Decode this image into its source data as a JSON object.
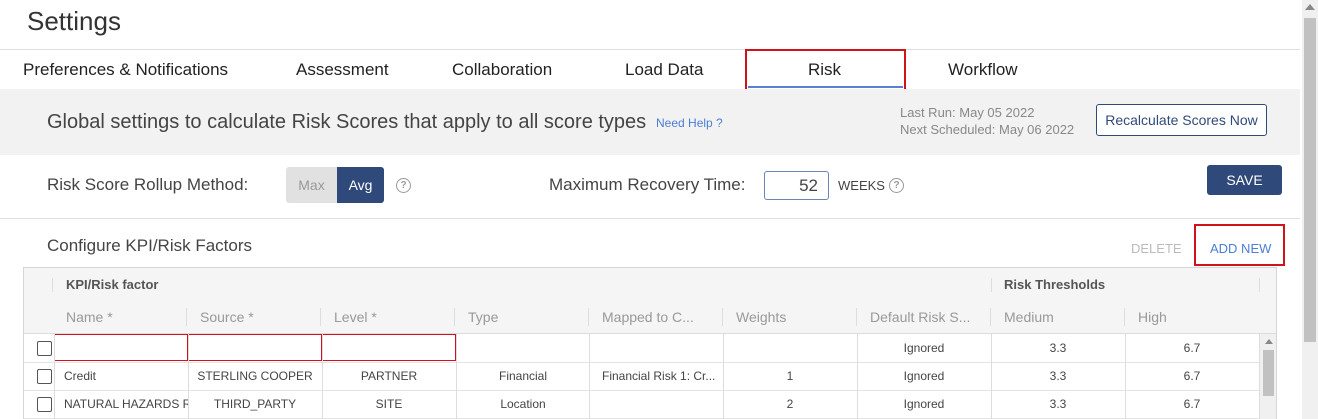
{
  "page": {
    "title": "Settings"
  },
  "tabs": [
    {
      "label": "Preferences & Notifications"
    },
    {
      "label": "Assessment"
    },
    {
      "label": "Collaboration"
    },
    {
      "label": "Load Data"
    },
    {
      "label": "Risk"
    },
    {
      "label": "Workflow"
    }
  ],
  "active_tab": "Risk",
  "global": {
    "text": "Global settings to calculate Risk Scores that apply to all score types",
    "help_link": "Need Help ?",
    "last_run": "Last Run: May 05 2022",
    "next_scheduled": "Next Scheduled: May 06 2022",
    "recalc_button": "Recalculate Scores Now"
  },
  "rollup": {
    "label": "Risk Score Rollup Method:",
    "options": [
      "Max",
      "Avg"
    ],
    "selected": "Avg"
  },
  "recovery": {
    "label": "Maximum Recovery Time:",
    "value": "52",
    "unit": "WEEKS"
  },
  "save_button": "SAVE",
  "kpi": {
    "title": "Configure KPI/Risk Factors",
    "delete_label": "DELETE",
    "add_new_label": "ADD NEW",
    "group_headers": {
      "factor": "KPI/Risk factor",
      "thresholds": "Risk Thresholds"
    },
    "columns": [
      "Name *",
      "Source *",
      "Level *",
      "Type",
      "Mapped to C...",
      "Weights",
      "Default Risk S...",
      "Medium",
      "High"
    ],
    "rows": [
      {
        "name": "",
        "source": "",
        "level": "",
        "type": "",
        "mapped": "",
        "weights": "",
        "default_risk": "Ignored",
        "medium": "3.3",
        "high": "6.7"
      },
      {
        "name": "Credit",
        "source": "STERLING COOPER",
        "level": "PARTNER",
        "type": "Financial",
        "mapped": "Financial Risk 1: Cr...",
        "weights": "1",
        "default_risk": "Ignored",
        "medium": "3.3",
        "high": "6.7"
      },
      {
        "name": "NATURAL HAZARDS RE",
        "source": "THIRD_PARTY",
        "level": "SITE",
        "type": "Location",
        "mapped": "",
        "weights": "2",
        "default_risk": "Ignored",
        "medium": "3.3",
        "high": "6.7"
      }
    ]
  },
  "icons": {
    "help": "question-circle-icon",
    "checkbox": "checkbox-icon",
    "scroll_up": "scroll-up-arrow-icon"
  },
  "colors": {
    "accent": "#2f4a7a",
    "highlight": "#d0121b",
    "link": "#4a7fd4",
    "tab_underline": "#5b7fd6"
  }
}
